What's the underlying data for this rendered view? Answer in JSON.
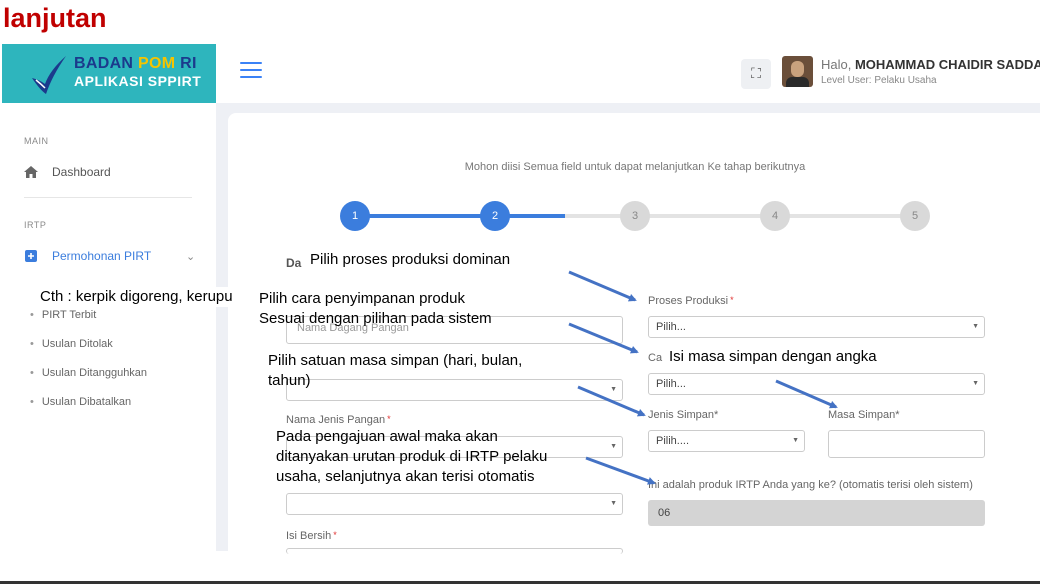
{
  "slide": {
    "title": "lanjutan"
  },
  "brand": {
    "line1_a": "BADAN ",
    "line1_b": "POM",
    "line1_c": " RI",
    "line2": "APLIKASI SPPIRT"
  },
  "header": {
    "greeting": "Halo, ",
    "user_name": "MOHAMMAD CHAIDIR SADDAK",
    "level": "Level User: Pelaku Usaha"
  },
  "sidebar": {
    "section_main": "MAIN",
    "dashboard": "Dashboard",
    "section_irtp": "IRTP",
    "permohonan": "Permohonan PIRT",
    "sub_items": [
      "PIRT Terbit",
      "Usulan Ditolak",
      "Usulan Ditangguhkan",
      "Usulan Dibatalkan"
    ]
  },
  "form": {
    "instruction": "Mohon diisi Semua field untuk dapat melanjutkan Ke tahap berikutnya",
    "steps": [
      "1",
      "2",
      "3",
      "4",
      "5"
    ],
    "active_steps": 2,
    "left_heading": "Da",
    "nama_dagang_placeholder": "Nama Dagang Pangan",
    "nama_jenis_pangan_label": "Nama Jenis Pangan",
    "isi_bersih_label": "Isi Bersih",
    "proses_produksi_label": "Proses Produksi",
    "proses_produksi_value": "Pilih...",
    "cara_label": "Ca",
    "cara_value": "Pilih...",
    "jenis_simpan_label": "Jenis Simpan*",
    "jenis_simpan_value": "Pilih....",
    "masa_simpan_label": "Masa Simpan*",
    "produk_ke_label": "Ini adalah produk IRTP Anda yang ke? (otomatis terisi oleh sistem)",
    "produk_ke_value": "06"
  },
  "annotations": {
    "proses": "Pilih proses produksi dominan",
    "contoh": "Cth : kerpik digoreng, kerupu",
    "penyimpanan_1": "Pilih cara penyimpanan produk",
    "penyimpanan_2": "Sesuai dengan pilihan pada sistem",
    "masa_angka": "Isi masa simpan dengan angka",
    "satuan": "Pilih satuan masa simpan (hari, bulan, tahun)",
    "urutan": "Pada pengajuan awal maka akan ditanyakan urutan produk di IRTP pelaku usaha, selanjutnya akan terisi otomatis"
  },
  "colors": {
    "accent": "#3b7ddd",
    "brand_bg": "#2eb5bd",
    "slide_title": "#c00000",
    "arrow": "#4472c4"
  }
}
